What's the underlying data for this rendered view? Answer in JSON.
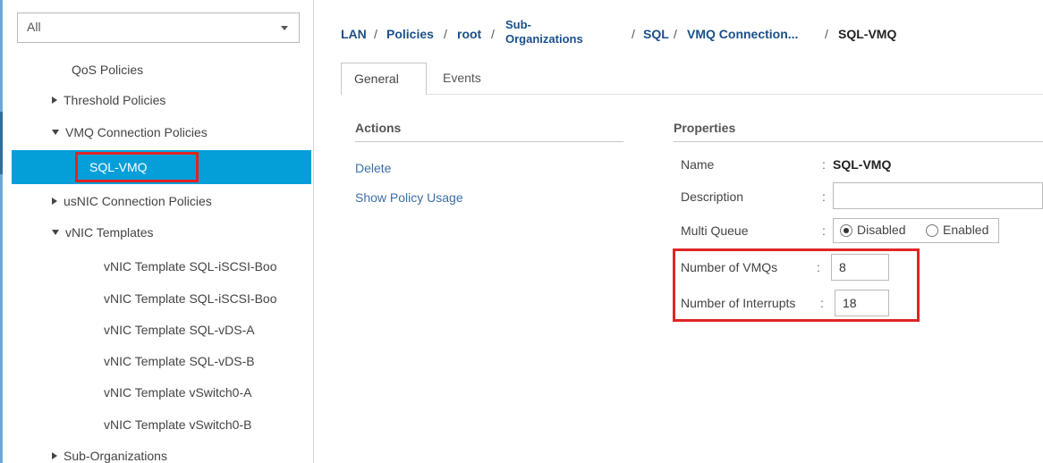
{
  "sidebar": {
    "filter_value": "All",
    "items": [
      {
        "label": "QoS Policies"
      },
      {
        "label": "Threshold Policies"
      },
      {
        "label": "VMQ Connection Policies"
      },
      {
        "label": "SQL-VMQ"
      },
      {
        "label": "usNIC Connection Policies"
      },
      {
        "label": "vNIC Templates"
      },
      {
        "label": "vNIC Template SQL-iSCSI-Boo"
      },
      {
        "label": "vNIC Template SQL-iSCSI-Boo"
      },
      {
        "label": "vNIC Template SQL-vDS-A"
      },
      {
        "label": "vNIC Template SQL-vDS-B"
      },
      {
        "label": "vNIC Template vSwitch0-A"
      },
      {
        "label": "vNIC Template vSwitch0-B"
      },
      {
        "label": "Sub-Organizations"
      }
    ]
  },
  "breadcrumb": {
    "lan": "LAN",
    "policies": "Policies",
    "root": "root",
    "sub_line1": "Sub-",
    "sub_line2": "Organizations",
    "sql": "SQL",
    "vmq": "VMQ Connection...",
    "current": "SQL-VMQ",
    "sep": "/"
  },
  "tabs": [
    {
      "label": "General"
    },
    {
      "label": "Events"
    }
  ],
  "actions": {
    "title": "Actions",
    "delete": "Delete",
    "show_usage": "Show Policy Usage"
  },
  "properties": {
    "title": "Properties",
    "colon": ":",
    "name_label": "Name",
    "name_value": "SQL-VMQ",
    "description_label": "Description",
    "description_value": "",
    "multi_queue_label": "Multi Queue",
    "multi_queue_options": [
      "Disabled",
      "Enabled"
    ],
    "vmqs_label": "Number of VMQs",
    "vmqs_value": "8",
    "interrupts_label": "Number of Interrupts",
    "interrupts_value": "18"
  },
  "colors": {
    "selection": "#049fd9",
    "highlight": "#e02424",
    "link": "#3c6fa8",
    "breadcrumb": "#1b4f8a"
  }
}
